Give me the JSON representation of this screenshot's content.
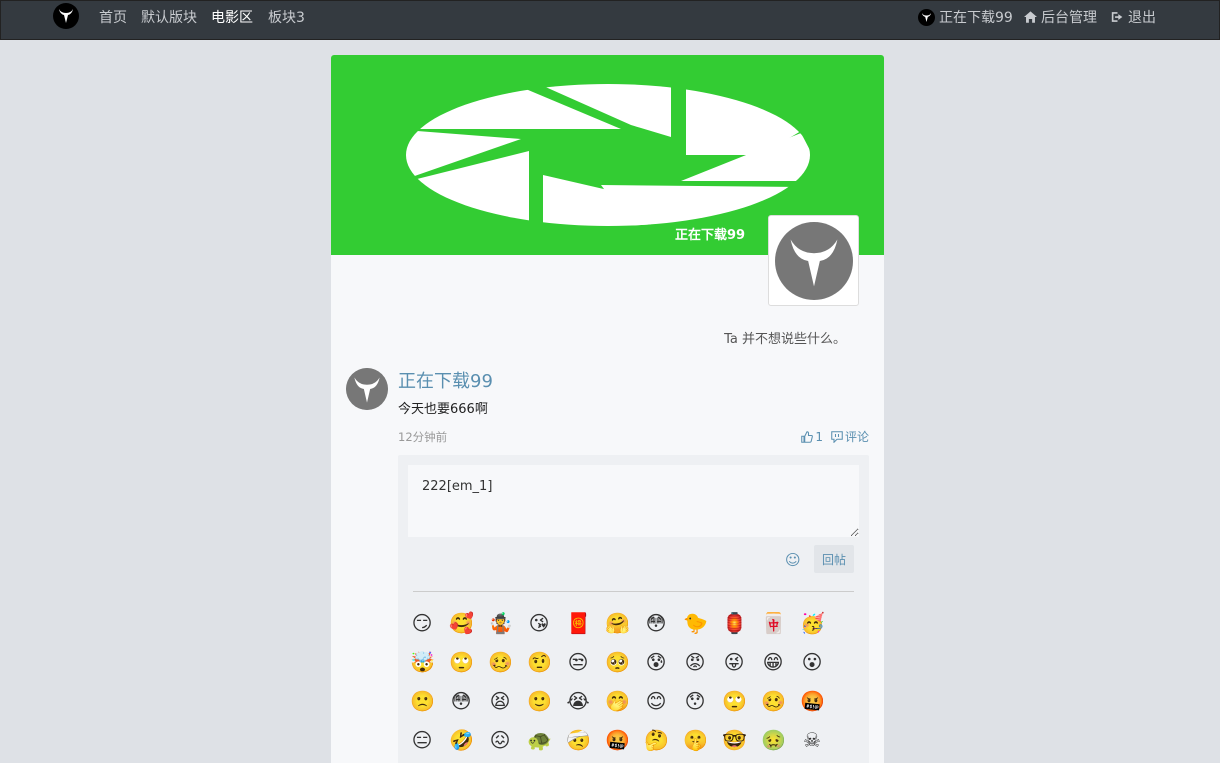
{
  "nav": {
    "links": [
      "首页",
      "默认版块",
      "电影区",
      "板块3"
    ],
    "user": "正在下载99",
    "admin": "后台管理",
    "logout": "退出"
  },
  "profile": {
    "name": "正在下载99",
    "bio": "Ta 并不想说些什么。",
    "banner_color": "#33cc33"
  },
  "post": {
    "author": "正在下载99",
    "content": "今天也要666啊",
    "time": "12分钟前",
    "likes": "1",
    "comment_label": "评论"
  },
  "reply": {
    "value": "222[em_1]",
    "submit_label": "回帖"
  },
  "emojis": [
    "😏",
    "🥰",
    "🤹",
    "😘",
    "🧧",
    "🤗",
    "😳",
    "🐤",
    "🏮",
    "🀄",
    "🥳",
    "🤯",
    "🙄",
    "🥴",
    "🤨",
    "😒",
    "🥺",
    "😰",
    "😡",
    "😜",
    "😁",
    "😮",
    "🙁",
    "😳",
    "😫",
    "🙂",
    "😭",
    "🤭",
    "😊",
    "😯",
    "🙄",
    "🥴",
    "🤬",
    "😑",
    "🤣",
    "😖",
    "🐢",
    "🤕",
    "🤬",
    "🤔",
    "🤫",
    "🤓",
    "🤢",
    "☠"
  ]
}
